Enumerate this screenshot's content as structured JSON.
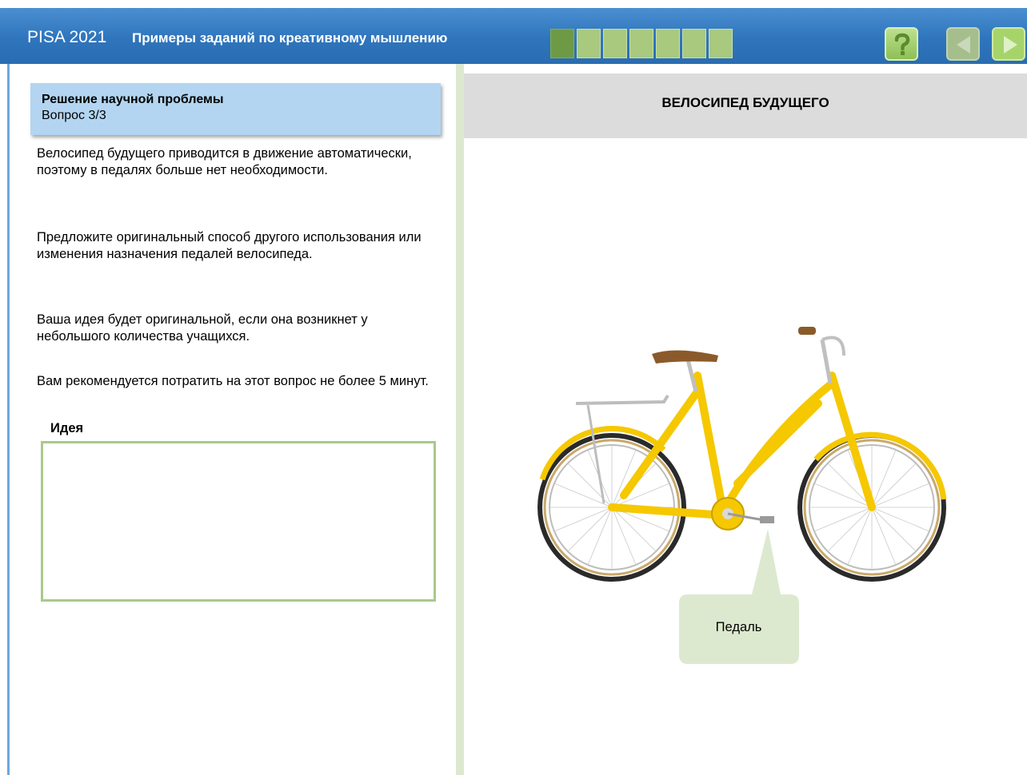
{
  "header": {
    "app_title": "PISA 2021",
    "subtitle": "Примеры заданий по креативному мышлению",
    "progress": {
      "total": 7,
      "current": 1
    },
    "help_icon": "question-mark-icon",
    "prev_icon": "arrow-left-icon",
    "next_icon": "arrow-right-icon"
  },
  "question": {
    "title": "Решение научной проблемы",
    "number": "Вопрос 3/3",
    "paragraphs": [
      "Велосипед будущего приводится в движение автоматически, поэтому в педалях больше нет необходимости.",
      "Предложите оригинальный способ другого использования или изменения назначения педалей велосипеда.",
      "Ваша идея будет оригинальной, если она возникнет у небольшого количества учащихся.",
      "Вам рекомендуется потратить на этот вопрос не более 5 минут."
    ],
    "idea_label": "Идея",
    "idea_value": ""
  },
  "stimulus": {
    "title": "ВЕЛОСИПЕД БУДУЩЕГО",
    "callout_label": "Педаль"
  },
  "colors": {
    "header_blue": "#2f75bd",
    "question_header": "#b3d5f1",
    "progress_active": "#6f9a45",
    "progress_inactive": "#a9c97e",
    "bike_yellow": "#f5c800",
    "callout_fill": "#dde9cf"
  }
}
